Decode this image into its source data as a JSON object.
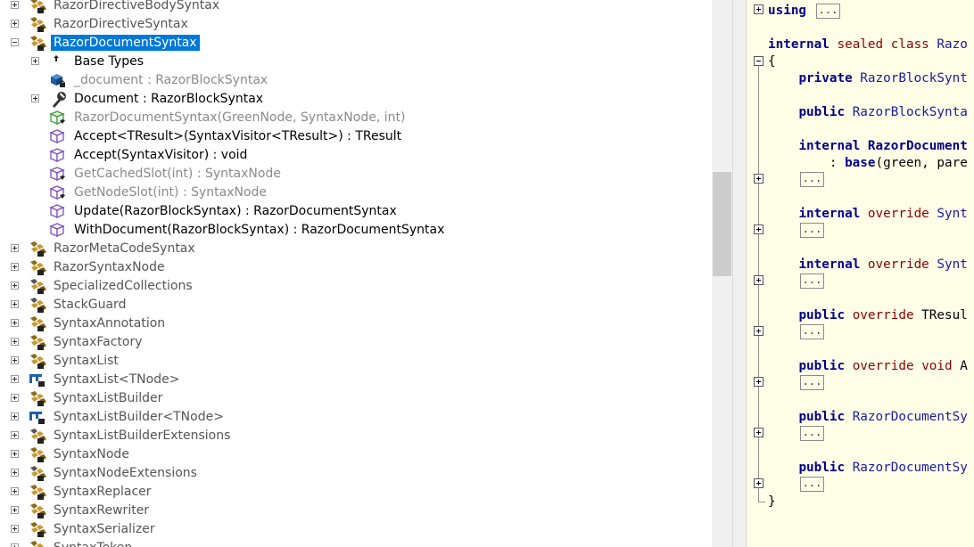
{
  "tree": {
    "items": [
      {
        "label": "RazorDirectiveBodySyntax",
        "indent": 0,
        "expander": "plus",
        "icon": "class-icon",
        "style": "normal"
      },
      {
        "label": "RazorDirectiveSyntax",
        "indent": 0,
        "expander": "plus",
        "icon": "class-icon",
        "style": "normal"
      },
      {
        "label": "RazorDocumentSyntax",
        "indent": 0,
        "expander": "minus",
        "icon": "class-icon",
        "style": "selected"
      },
      {
        "label": "Base Types",
        "indent": 1,
        "expander": "plus",
        "icon": "base-types-icon",
        "style": "dark"
      },
      {
        "label": "_document : RazorBlockSyntax",
        "indent": 1,
        "expander": "none",
        "icon": "private-field-icon",
        "style": "gray"
      },
      {
        "label": "Document : RazorBlockSyntax",
        "indent": 1,
        "expander": "plus",
        "icon": "property-wrench-icon",
        "style": "dark"
      },
      {
        "label": "RazorDocumentSyntax(GreenNode, SyntaxNode, int)",
        "indent": 1,
        "expander": "none",
        "icon": "internal-constructor-icon",
        "style": "gray"
      },
      {
        "label": "Accept<TResult>(SyntaxVisitor<TResult>) : TResult",
        "indent": 1,
        "expander": "none",
        "icon": "method-icon",
        "style": "dark"
      },
      {
        "label": "Accept(SyntaxVisitor) : void",
        "indent": 1,
        "expander": "none",
        "icon": "method-icon",
        "style": "dark"
      },
      {
        "label": "GetCachedSlot(int) : SyntaxNode",
        "indent": 1,
        "expander": "none",
        "icon": "internal-method-icon",
        "style": "gray"
      },
      {
        "label": "GetNodeSlot(int) : SyntaxNode",
        "indent": 1,
        "expander": "none",
        "icon": "internal-method-icon",
        "style": "gray"
      },
      {
        "label": "Update(RazorBlockSyntax) : RazorDocumentSyntax",
        "indent": 1,
        "expander": "none",
        "icon": "method-icon",
        "style": "dark"
      },
      {
        "label": "WithDocument(RazorBlockSyntax) : RazorDocumentSyntax",
        "indent": 1,
        "expander": "none",
        "icon": "method-icon",
        "style": "dark"
      },
      {
        "label": "RazorMetaCodeSyntax",
        "indent": 0,
        "expander": "plus",
        "icon": "class-icon",
        "style": "normal"
      },
      {
        "label": "RazorSyntaxNode",
        "indent": 0,
        "expander": "plus",
        "icon": "class-icon",
        "style": "normal"
      },
      {
        "label": "SpecializedCollections",
        "indent": 0,
        "expander": "plus",
        "icon": "static-class-icon",
        "style": "normal"
      },
      {
        "label": "StackGuard",
        "indent": 0,
        "expander": "plus",
        "icon": "static-class-icon",
        "style": "normal"
      },
      {
        "label": "SyntaxAnnotation",
        "indent": 0,
        "expander": "plus",
        "icon": "class-icon",
        "style": "normal"
      },
      {
        "label": "SyntaxFactory",
        "indent": 0,
        "expander": "plus",
        "icon": "class-icon",
        "style": "normal"
      },
      {
        "label": "SyntaxList",
        "indent": 0,
        "expander": "plus",
        "icon": "class-icon",
        "style": "normal"
      },
      {
        "label": "SyntaxList<TNode>",
        "indent": 0,
        "expander": "plus",
        "icon": "struct-icon",
        "style": "normal"
      },
      {
        "label": "SyntaxListBuilder",
        "indent": 0,
        "expander": "plus",
        "icon": "class-icon",
        "style": "normal"
      },
      {
        "label": "SyntaxListBuilder<TNode>",
        "indent": 0,
        "expander": "plus",
        "icon": "struct-icon",
        "style": "normal"
      },
      {
        "label": "SyntaxListBuilderExtensions",
        "indent": 0,
        "expander": "plus",
        "icon": "static-class-icon",
        "style": "normal"
      },
      {
        "label": "SyntaxNode",
        "indent": 0,
        "expander": "plus",
        "icon": "class-icon",
        "style": "normal"
      },
      {
        "label": "SyntaxNodeExtensions",
        "indent": 0,
        "expander": "plus",
        "icon": "static-class-icon",
        "style": "normal"
      },
      {
        "label": "SyntaxReplacer",
        "indent": 0,
        "expander": "plus",
        "icon": "class-icon",
        "style": "normal"
      },
      {
        "label": "SyntaxRewriter",
        "indent": 0,
        "expander": "plus",
        "icon": "class-icon",
        "style": "normal"
      },
      {
        "label": "SyntaxSerializer",
        "indent": 0,
        "expander": "plus",
        "icon": "class-icon",
        "style": "normal"
      },
      {
        "label": "SyntaxToken",
        "indent": 0,
        "expander": "plus",
        "icon": "class-icon",
        "style": "normal"
      }
    ]
  },
  "code": {
    "ellipsis": "...",
    "lines": [
      [
        {
          "t": "using",
          "c": "kw"
        },
        {
          "t": " ",
          "c": ""
        }
      ],
      [
        {
          "t": "internal",
          "c": "kw"
        },
        {
          "t": " ",
          "c": ""
        },
        {
          "t": "sealed",
          "c": "kw2"
        },
        {
          "t": " ",
          "c": ""
        },
        {
          "t": "class",
          "c": "kw2"
        },
        {
          "t": " Razo",
          "c": "ty"
        }
      ],
      [
        {
          "t": "{",
          "c": ""
        }
      ],
      [
        {
          "t": "    ",
          "c": ""
        },
        {
          "t": "private",
          "c": "kw"
        },
        {
          "t": " RazorBlockSynt",
          "c": "ty"
        }
      ],
      [
        {
          "t": "    ",
          "c": ""
        },
        {
          "t": "public",
          "c": "kw"
        },
        {
          "t": " RazorBlockSynta",
          "c": "ty"
        }
      ],
      [
        {
          "t": "    ",
          "c": ""
        },
        {
          "t": "internal",
          "c": "kw"
        },
        {
          "t": " ",
          "c": ""
        },
        {
          "t": "RazorDocument",
          "c": "kw"
        }
      ],
      [
        {
          "t": "        : ",
          "c": ""
        },
        {
          "t": "base",
          "c": "kw"
        },
        {
          "t": "(green, pare",
          "c": ""
        }
      ],
      [
        {
          "t": "    ",
          "c": ""
        },
        {
          "t": "internal",
          "c": "kw"
        },
        {
          "t": " ",
          "c": ""
        },
        {
          "t": "override",
          "c": "kw2"
        },
        {
          "t": " Synt",
          "c": "ty"
        }
      ],
      [
        {
          "t": "    ",
          "c": ""
        },
        {
          "t": "internal",
          "c": "kw"
        },
        {
          "t": " ",
          "c": ""
        },
        {
          "t": "override",
          "c": "kw2"
        },
        {
          "t": " Synt",
          "c": "ty"
        }
      ],
      [
        {
          "t": "    ",
          "c": ""
        },
        {
          "t": "public",
          "c": "kw"
        },
        {
          "t": " ",
          "c": ""
        },
        {
          "t": "override",
          "c": "kw2"
        },
        {
          "t": " TResul",
          "c": ""
        }
      ],
      [
        {
          "t": "    ",
          "c": ""
        },
        {
          "t": "public",
          "c": "kw"
        },
        {
          "t": " ",
          "c": ""
        },
        {
          "t": "override",
          "c": "kw2"
        },
        {
          "t": " ",
          "c": ""
        },
        {
          "t": "void",
          "c": "kw2"
        },
        {
          "t": " A",
          "c": ""
        }
      ],
      [
        {
          "t": "    ",
          "c": ""
        },
        {
          "t": "public",
          "c": "kw"
        },
        {
          "t": " RazorDocumentSy",
          "c": "ty"
        }
      ],
      [
        {
          "t": "    ",
          "c": ""
        },
        {
          "t": "public",
          "c": "kw"
        },
        {
          "t": " RazorDocumentSy",
          "c": "ty"
        }
      ],
      [
        {
          "t": "}",
          "c": ""
        }
      ]
    ]
  }
}
